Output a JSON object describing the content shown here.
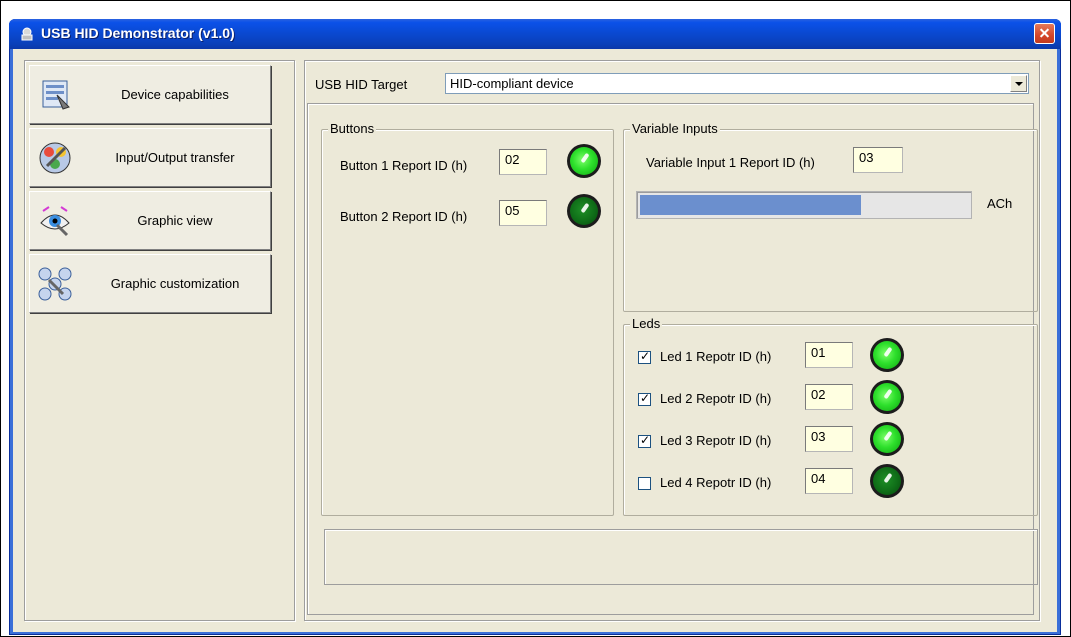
{
  "window": {
    "title": "USB HID Demonstrator (v1.0)"
  },
  "nav": [
    {
      "label": "Device capabilities",
      "icon": "device-capabilities-icon"
    },
    {
      "label": "Input/Output transfer",
      "icon": "io-transfer-icon"
    },
    {
      "label": "Graphic view",
      "icon": "graphic-view-icon"
    },
    {
      "label": "Graphic customization",
      "icon": "graphic-customization-icon"
    }
  ],
  "target": {
    "label": "USB HID Target",
    "value": "HID-compliant device"
  },
  "buttons": {
    "title": "Buttons",
    "items": [
      {
        "label": "Button 1 Report ID (h)",
        "value": "02",
        "state": "on"
      },
      {
        "label": "Button 2 Report ID (h)",
        "value": "05",
        "state": "off"
      }
    ]
  },
  "variable_inputs": {
    "title": "Variable Inputs",
    "label": "Variable Input 1 Report ID (h)",
    "value": "03",
    "level_text": "ACh",
    "level_fraction": 0.675
  },
  "leds": {
    "title": "Leds",
    "items": [
      {
        "label": "Led 1 Repotr ID (h)",
        "value": "01",
        "checked": true,
        "state": "on"
      },
      {
        "label": "Led 2 Repotr ID (h)",
        "value": "02",
        "checked": true,
        "state": "on"
      },
      {
        "label": "Led 3 Repotr ID (h)",
        "value": "03",
        "checked": true,
        "state": "on"
      },
      {
        "label": "Led 4 Repotr ID (h)",
        "value": "04",
        "checked": false,
        "state": "off"
      }
    ]
  },
  "colors": {
    "titlebar": "#0a47cc",
    "panel": "#ece9d8",
    "led_on": "#2ee02c",
    "led_off": "#0f6d18",
    "progress": "#6b8fce"
  }
}
